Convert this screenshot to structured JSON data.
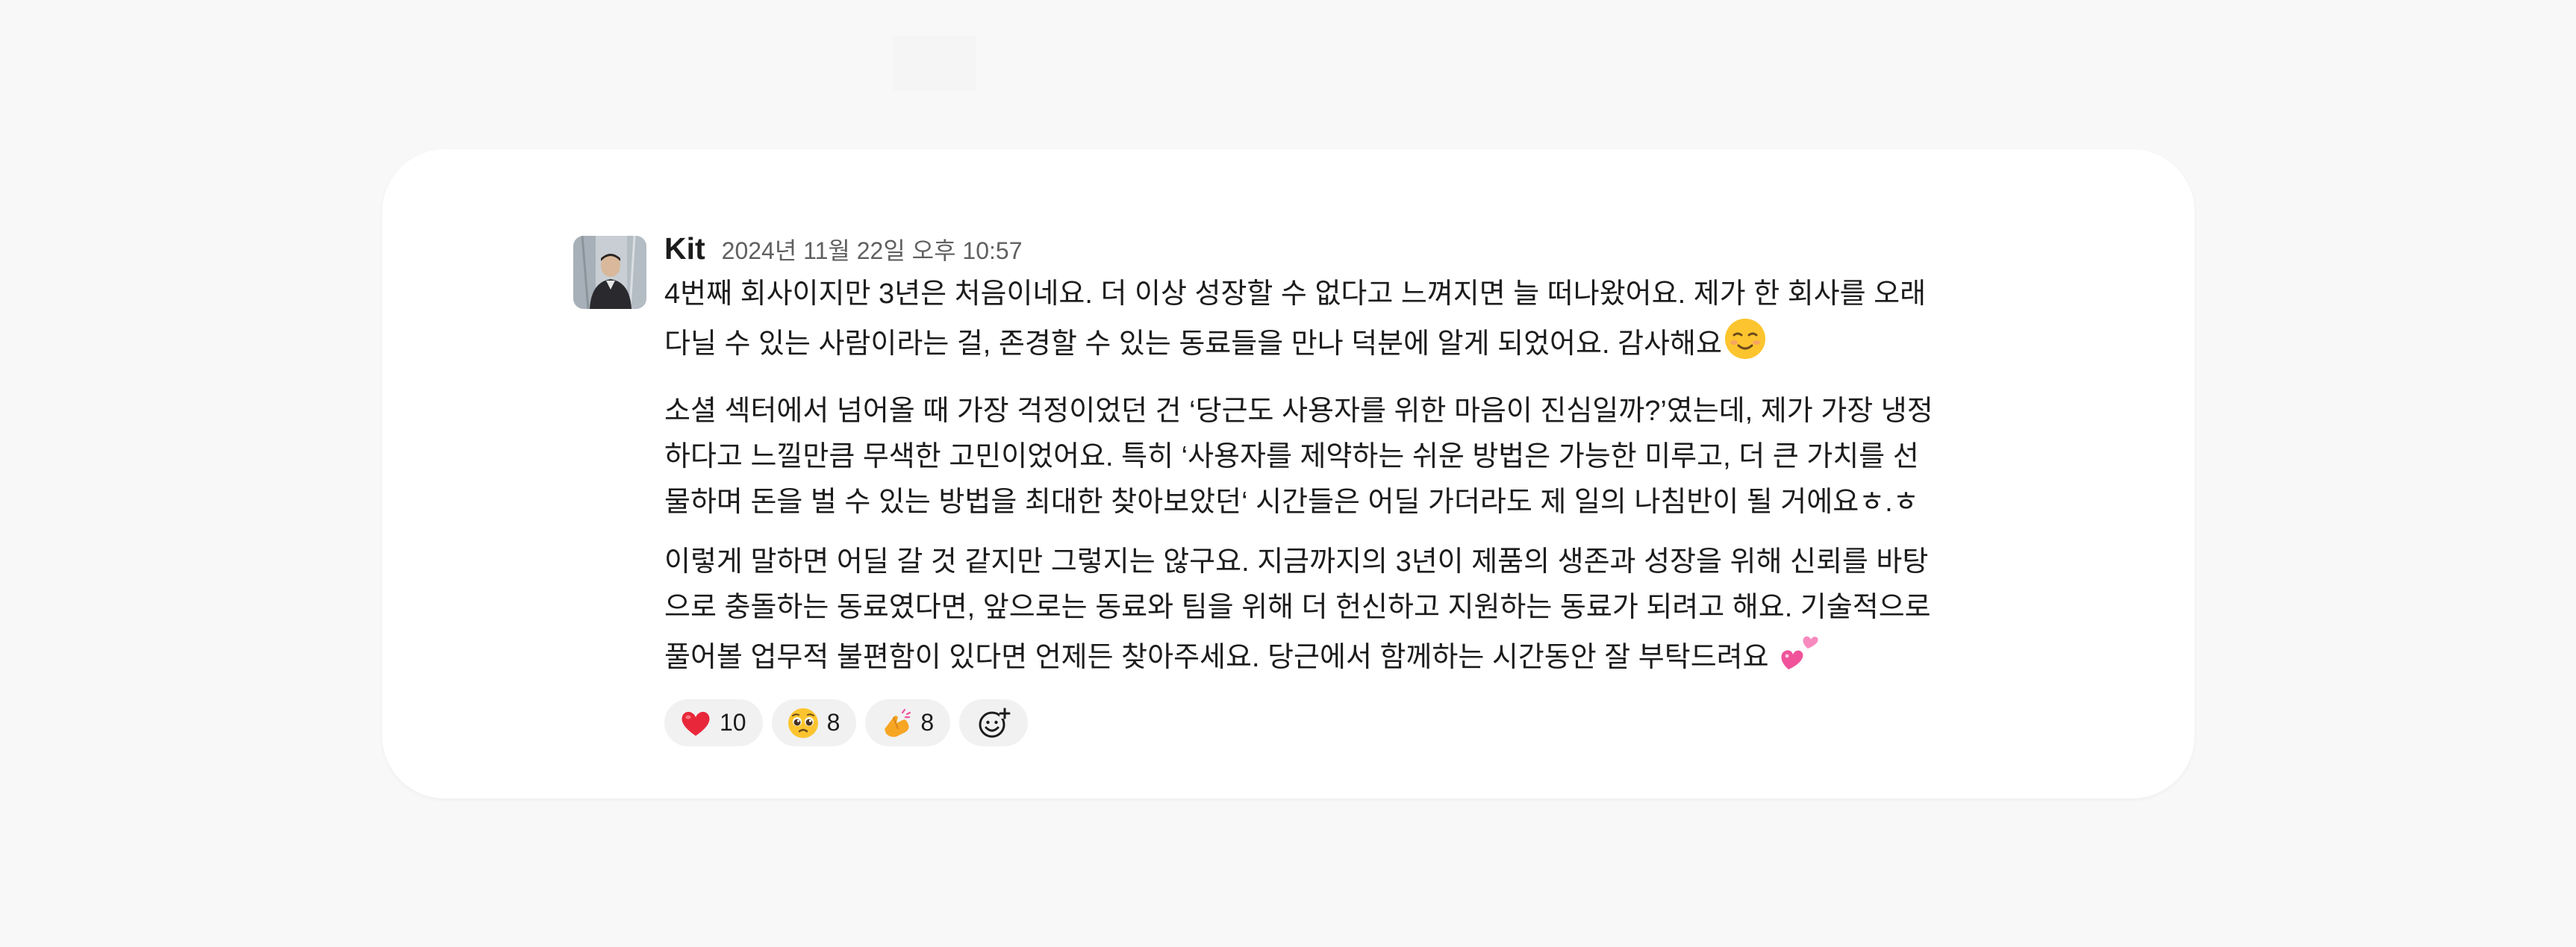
{
  "message": {
    "author": "Kit",
    "timestamp": "2024년 11월 22일 오후 10:57",
    "paragraphs": [
      {
        "lines": [
          "4번째 회사이지만 3년은 처음이네요. 더 이상 성장할 수 없다고 느껴지면 늘 떠나왔어요. 제가 한 회사를 오래",
          "다닐 수 있는 사람이라는 걸, 존경할 수 있는 동료들을 만나 덕분에 알게 되었어요. 감사해요"
        ],
        "trailing_emoji": "relieved-smile-emoji"
      },
      {
        "lines": [
          "소셜 섹터에서 넘어올 때 가장 걱정이었던 건 ‘당근도 사용자를 위한 마음이 진심일까?’였는데, 제가 가장 냉정",
          "하다고 느낄만큼 무색한 고민이었어요. 특히 ‘사용자를 제약하는 쉬운 방법은 가능한 미루고, 더 큰 가치를 선",
          "물하며 돈을 벌 수 있는 방법을 최대한 찾아보았던‘ 시간들은 어딜 가더라도 제 일의 나침반이 될 거에요ㅎ.ㅎ"
        ]
      },
      {
        "lines": [
          "이렇게 말하면 어딜 갈 것 같지만 그렇지는 않구요. 지금까지의 3년이 제품의 생존과 성장을 위해 신뢰를 바탕",
          "으로 충돌하는 동료였다면, 앞으로는 동료와 팀을 위해 더 헌신하고 지원하는 동료가 되려고 해요. 기술적으로",
          "풀어볼 업무적 불편함이 있다면 언제든 찾아주세요. 당근에서 함께하는 시간동안 잘 부탁드려요 "
        ],
        "trailing_emoji": "two-hearts-emoji"
      }
    ],
    "reactions": [
      {
        "icon": "red-heart-emoji",
        "count": "10"
      },
      {
        "icon": "pleading-face-emoji",
        "count": "8"
      },
      {
        "icon": "folded-hands-emoji",
        "count": "8"
      }
    ],
    "add_reaction_icon": "add-reaction-icon"
  },
  "colors": {
    "background": "#f8f8f9",
    "card": "#ffffff",
    "text": "#1d1c1d",
    "muted": "#616061",
    "reaction_bg": "#f1f1f2",
    "heart": "#e8283a",
    "emoji_yellow": "#fcc52f",
    "pink": "#f0539a"
  }
}
